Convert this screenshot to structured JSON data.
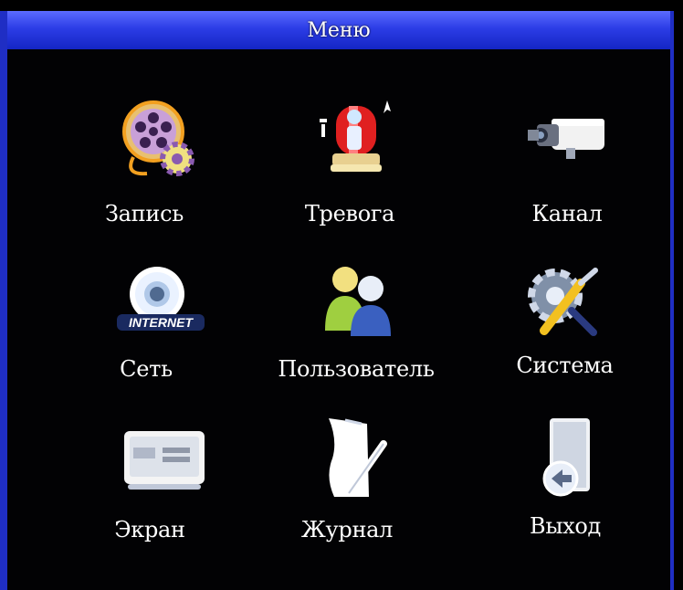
{
  "window": {
    "title": "Меню"
  },
  "menu": {
    "items": [
      {
        "label": "Запись",
        "icon": "record-reel-gear-icon"
      },
      {
        "label": "Тревога",
        "icon": "alarm-siren-icon"
      },
      {
        "label": "Канал",
        "icon": "camera-channel-icon"
      },
      {
        "label": "Сеть",
        "icon": "internet-network-icon"
      },
      {
        "label": "Пользователь",
        "icon": "users-icon"
      },
      {
        "label": "Система",
        "icon": "system-tools-icon"
      },
      {
        "label": "Экран",
        "icon": "monitor-screen-icon"
      },
      {
        "label": "Журнал",
        "icon": "log-journal-icon"
      },
      {
        "label": "Выход",
        "icon": "exit-door-icon"
      }
    ]
  },
  "icon_text": {
    "internet": "INTERNET"
  }
}
